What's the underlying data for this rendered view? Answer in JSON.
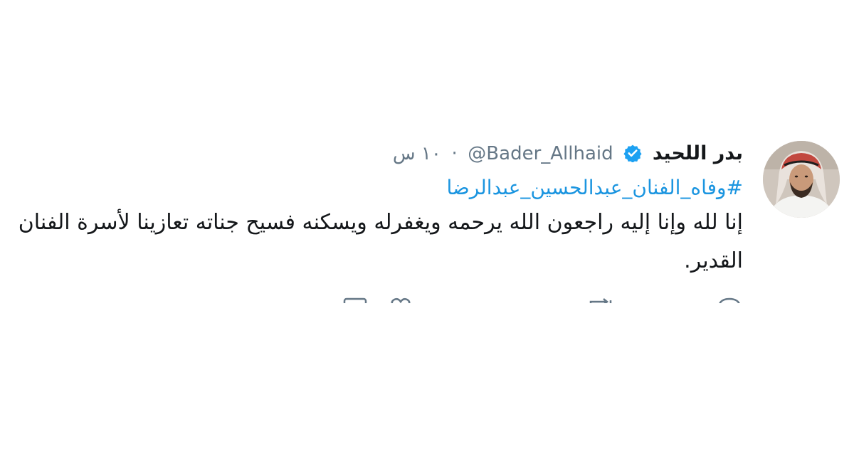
{
  "tweet": {
    "display_name": "بدر اللحيد",
    "handle": "@Bader_Allhaid",
    "separator": "·",
    "time": "١٠ س",
    "hashtag": "#وفاه_الفنان_عبدالحسين_عبدالرضا",
    "body": "إنا لله وإنا إليه راجعون الله يرحمه ويغفرله ويسكنه فسيح جناته تعازينا لأسرة الفنان القدير.",
    "verified_icon": "verified-badge-icon",
    "avatar_icon": "user-avatar-photo",
    "colors": {
      "name": "#14171a",
      "meta": "#657786",
      "hashtag": "#1b95e0",
      "verified": "#1da1f2"
    }
  },
  "actions": {
    "icons": [
      "reply-icon",
      "retweet-icon",
      "like-icon",
      "message-icon"
    ]
  }
}
